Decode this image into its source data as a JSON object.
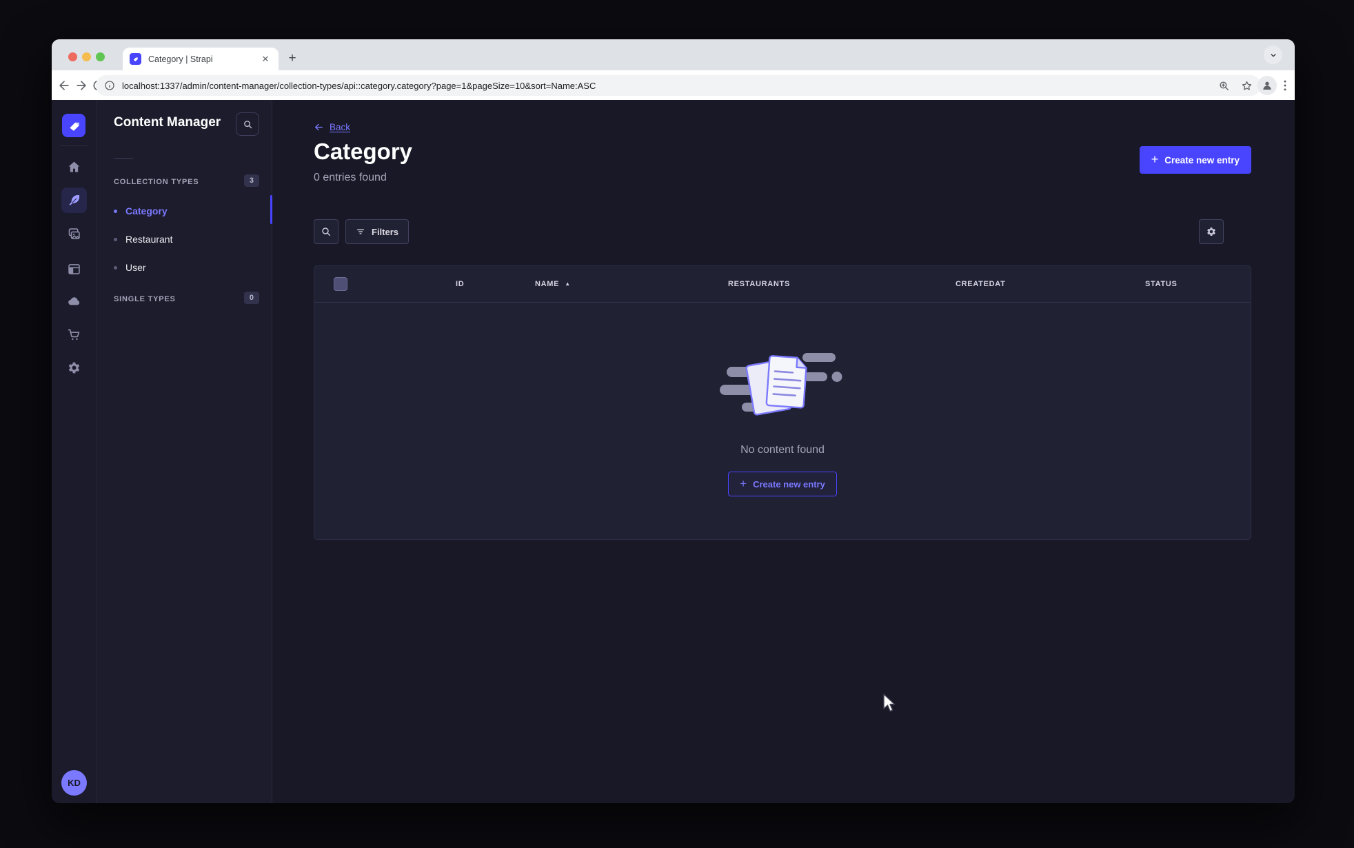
{
  "browser": {
    "tab_title": "Category | Strapi",
    "url": "localhost:1337/admin/content-manager/collection-types/api::category.category?page=1&pageSize=10&sort=Name:ASC",
    "close_glyph": "✕",
    "new_tab_glyph": "+"
  },
  "sidebar": {
    "title": "Content Manager",
    "sections": [
      {
        "label": "COLLECTION TYPES",
        "count": "3",
        "items": [
          {
            "label": "Category"
          },
          {
            "label": "Restaurant"
          },
          {
            "label": "User"
          }
        ]
      },
      {
        "label": "SINGLE TYPES",
        "count": "0",
        "items": []
      }
    ]
  },
  "user": {
    "initials": "KD"
  },
  "main": {
    "back_label": "Back",
    "title": "Category",
    "subtitle": "0 entries found",
    "create_button": "Create new entry",
    "filters_button": "Filters",
    "table": {
      "headers": [
        "ID",
        "NAME",
        "RESTAURANTS",
        "CREATEDAT",
        "STATUS"
      ],
      "sort_asc_glyph": "▲"
    },
    "empty": {
      "message": "No content found",
      "cta": "Create new entry"
    }
  },
  "help": {
    "glyph": "?"
  },
  "icons": {
    "plus": "+",
    "strapi-logo": "purple rounded square with white arrow",
    "search-icon": "magnifier",
    "filter-icon": "three decreasing lines",
    "gear-icon": "cog",
    "question-icon": "circled question mark"
  },
  "colors": {
    "accent": "#4945ff",
    "accent_light": "#7b79ff",
    "page_bg": "#181826",
    "card_bg": "#212134",
    "chrome_bg": "#dee1e6"
  }
}
